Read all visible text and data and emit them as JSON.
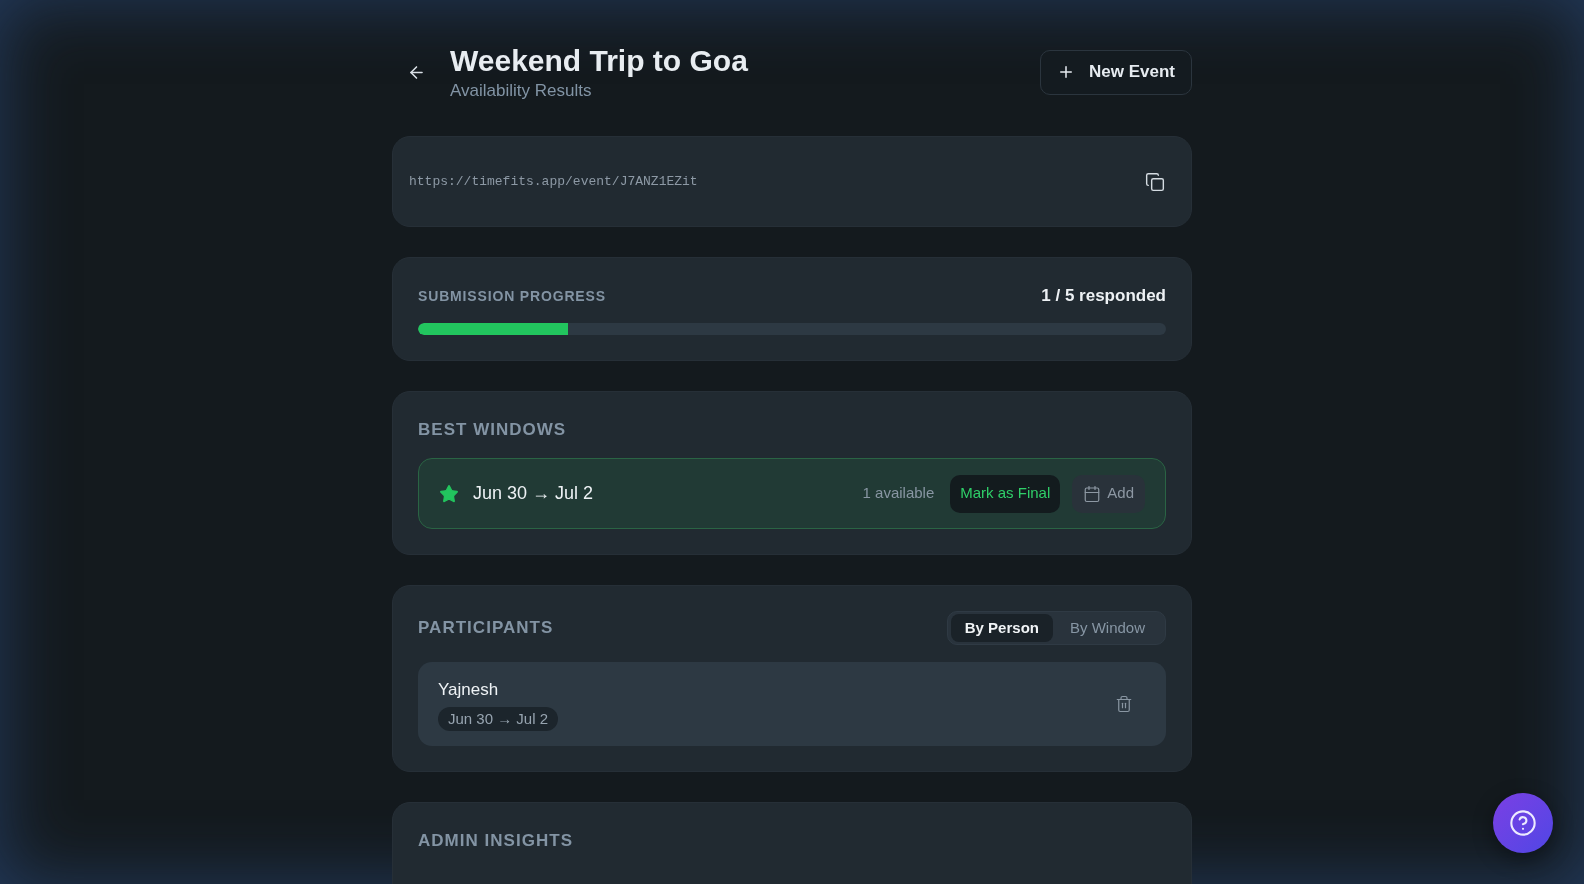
{
  "header": {
    "title": "Weekend Trip to Goa",
    "subtitle": "Availability Results",
    "new_event_button": "New Event"
  },
  "share_link": {
    "url": "https://timefits.app/event/J7ANZ1EZit"
  },
  "submission_progress": {
    "label": "SUBMISSION PROGRESS",
    "reading": "1 / 5 responded",
    "level": 0.2
  },
  "best_windows": {
    "title": "BEST WINDOWS",
    "windows": [
      {
        "range": "Jun 30 → Jul 2",
        "availability": "1 available",
        "actions": [
          {
            "kind": "final",
            "label": "Mark as Final"
          },
          {
            "kind": "calendar",
            "label": "Add"
          }
        ]
      }
    ]
  },
  "participants": {
    "title": "PARTICIPANTS",
    "view_tabs": [
      {
        "label": "By Person",
        "selected": true
      },
      {
        "label": "By Window",
        "selected": false
      }
    ],
    "people": [
      {
        "name": "Yajnesh",
        "windows": [
          "Jun 30 → Jul 2"
        ]
      }
    ]
  },
  "admin_insights": {
    "title": "ADMIN INSIGHTS"
  }
}
